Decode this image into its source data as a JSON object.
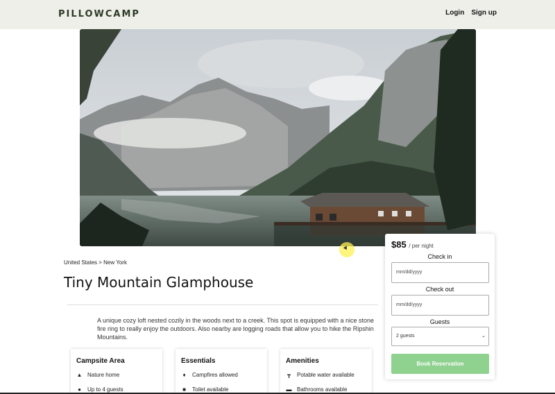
{
  "header": {
    "logo": "PILLOWCAMP",
    "login": "Login",
    "signup": "Sign up"
  },
  "listing": {
    "breadcrumb": "United States > New York",
    "title": "Tiny Mountain Glamphouse",
    "description": "A unique cozy loft nested cozily in the woods next to a creek. This spot is equipped with a nice stone fire ring to really enjoy the outdoors. Also nearby are logging roads that allow you to hike the Ripshin Mountains."
  },
  "cards": [
    {
      "title": "Campsite Area",
      "items": [
        {
          "icon": "tent-icon",
          "label": "Nature home"
        },
        {
          "icon": "people-icon",
          "label": "Up to 4 guests"
        }
      ]
    },
    {
      "title": "Essentials",
      "items": [
        {
          "icon": "flame-icon",
          "label": "Campfires allowed"
        },
        {
          "icon": "toilet-icon",
          "label": "Toilet available"
        }
      ]
    },
    {
      "title": "Amenities",
      "items": [
        {
          "icon": "faucet-icon",
          "label": "Potable water available"
        },
        {
          "icon": "bath-icon",
          "label": "Bathrooms available"
        }
      ]
    }
  ],
  "booking": {
    "price": "$85",
    "per_night": "/ per night",
    "check_in_label": "Check in",
    "check_in_placeholder": "mm/dd/yyyy",
    "check_out_label": "Check out",
    "check_out_placeholder": "mm/dd/yyyy",
    "guests_label": "Guests",
    "guests_value": "2 guests",
    "book_label": "Book Reservation",
    "book_color": "#8fd18f"
  }
}
